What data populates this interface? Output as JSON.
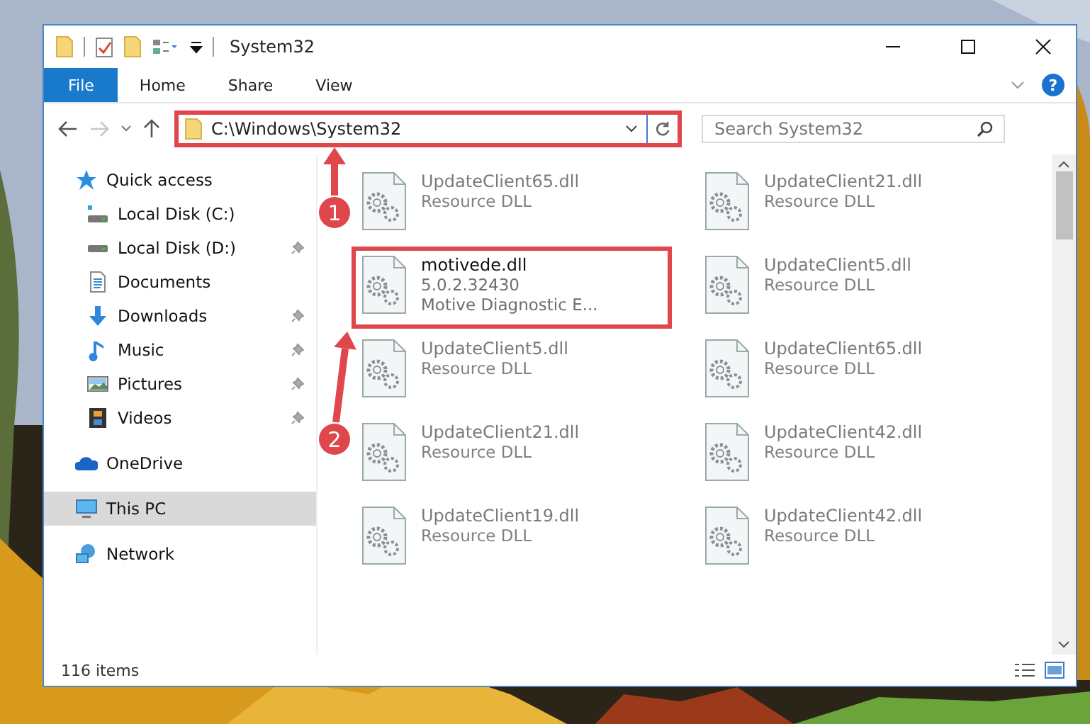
{
  "window": {
    "title": "System32",
    "controls": [
      {
        "kind": "minimize"
      },
      {
        "kind": "maximize"
      },
      {
        "kind": "close"
      }
    ]
  },
  "ribbon": {
    "tabs": [
      {
        "label": "File",
        "selected": true
      },
      {
        "label": "Home",
        "selected": false
      },
      {
        "label": "Share",
        "selected": false
      },
      {
        "label": "View",
        "selected": false
      }
    ],
    "help": "?"
  },
  "address": {
    "path": "C:\\Windows\\System32",
    "callout": true
  },
  "search": {
    "placeholder": "Search System32"
  },
  "sidebar": {
    "items": [
      {
        "label": "Quick access",
        "kind": "star",
        "pinned": false,
        "selected": false,
        "children": [
          {
            "label": "Local Disk (C:)",
            "kind": "system-drive",
            "pinned": false,
            "selected": false
          },
          {
            "label": "Local Disk (D:)",
            "kind": "drive",
            "pinned": true,
            "selected": false
          },
          {
            "label": "Documents",
            "kind": "document",
            "pinned": false,
            "selected": false
          },
          {
            "label": "Downloads",
            "kind": "download",
            "pinned": true,
            "selected": false
          },
          {
            "label": "Music",
            "kind": "music",
            "pinned": true,
            "selected": false
          },
          {
            "label": "Pictures",
            "kind": "pictures",
            "pinned": true,
            "selected": false
          },
          {
            "label": "Videos",
            "kind": "videos",
            "pinned": true,
            "selected": false
          }
        ]
      },
      {
        "label": "OneDrive",
        "kind": "cloud",
        "pinned": false,
        "selected": false
      },
      {
        "label": "This PC",
        "kind": "computer",
        "pinned": false,
        "selected": true
      },
      {
        "label": "Network",
        "kind": "network",
        "pinned": false,
        "selected": false
      }
    ]
  },
  "files": [
    {
      "name": "UpdateClient65.dll",
      "details": [
        "Resource DLL"
      ],
      "callout": false
    },
    {
      "name": "UpdateClient21.dll",
      "details": [
        "Resource DLL"
      ],
      "callout": false
    },
    {
      "name": "motivede.dll",
      "details": [
        "5.0.2.32430",
        "Motive Diagnostic E..."
      ],
      "callout": true
    },
    {
      "name": "UpdateClient5.dll",
      "details": [
        "Resource DLL"
      ],
      "callout": false
    },
    {
      "name": "UpdateClient5.dll",
      "details": [
        "Resource DLL"
      ],
      "callout": false
    },
    {
      "name": "UpdateClient65.dll",
      "details": [
        "Resource DLL"
      ],
      "callout": false
    },
    {
      "name": "UpdateClient21.dll",
      "details": [
        "Resource DLL"
      ],
      "callout": false
    },
    {
      "name": "UpdateClient42.dll",
      "details": [
        "Resource DLL"
      ],
      "callout": false
    },
    {
      "name": "UpdateClient19.dll",
      "details": [
        "Resource DLL"
      ],
      "callout": false
    },
    {
      "name": "UpdateClient42.dll",
      "details": [
        "Resource DLL"
      ],
      "callout": false
    }
  ],
  "status_bar": {
    "text": "116 items"
  },
  "steps": [
    {
      "label": "1"
    },
    {
      "label": "2"
    }
  ]
}
